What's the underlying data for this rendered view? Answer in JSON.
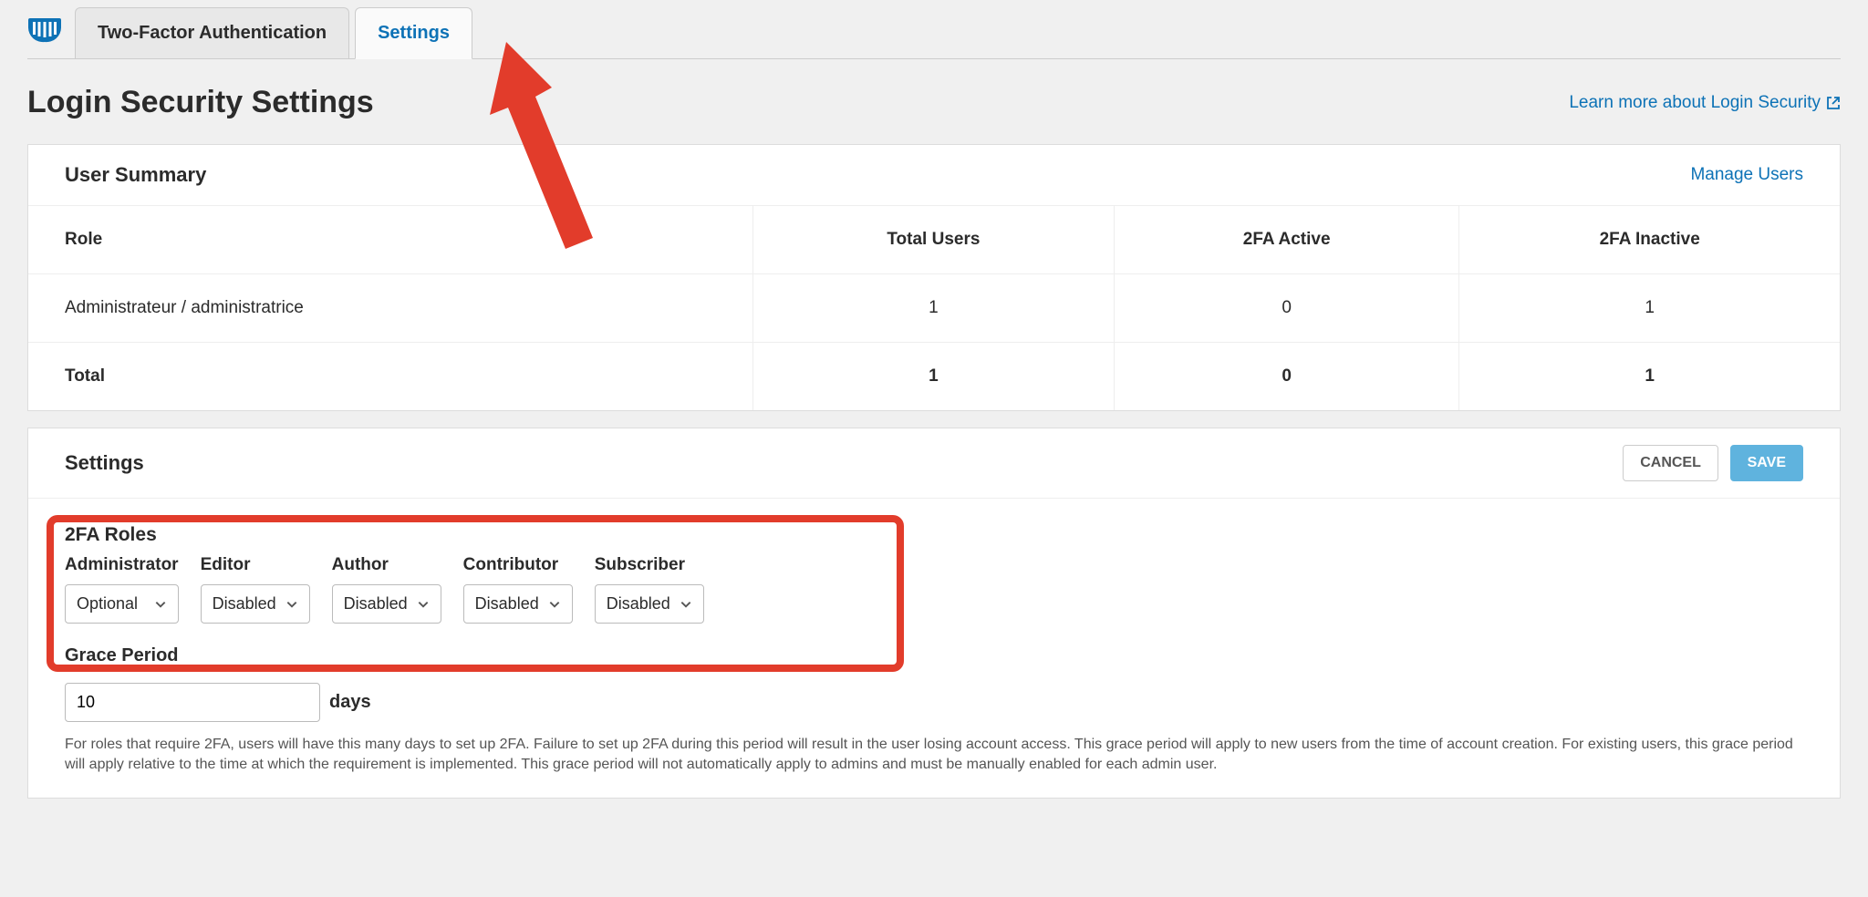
{
  "tabs": {
    "tfa": "Two-Factor Authentication",
    "settings": "Settings"
  },
  "header": {
    "title": "Login Security Settings",
    "learn_more": "Learn more about Login Security"
  },
  "user_summary": {
    "title": "User Summary",
    "manage_link": "Manage Users",
    "cols": {
      "role": "Role",
      "total": "Total Users",
      "active": "2FA Active",
      "inactive": "2FA Inactive"
    },
    "rows": [
      {
        "role": "Administrateur / administratrice",
        "total": "1",
        "active": "0",
        "inactive": "1"
      }
    ],
    "total_row": {
      "role": "Total",
      "total": "1",
      "active": "0",
      "inactive": "1"
    }
  },
  "settings": {
    "title": "Settings",
    "cancel": "CANCEL",
    "save": "SAVE",
    "tfa_roles_label": "2FA Roles",
    "roles": [
      {
        "name": "Administrator",
        "value": "Optional"
      },
      {
        "name": "Editor",
        "value": "Disabled"
      },
      {
        "name": "Author",
        "value": "Disabled"
      },
      {
        "name": "Contributor",
        "value": "Disabled"
      },
      {
        "name": "Subscriber",
        "value": "Disabled"
      }
    ],
    "grace": {
      "label": "Grace Period",
      "value": "10",
      "unit": "days",
      "help": "For roles that require 2FA, users will have this many days to set up 2FA. Failure to set up 2FA during this period will result in the user losing account access. This grace period will apply to new users from the time of account creation. For existing users, this grace period will apply relative to the time at which the requirement is implemented. This grace period will not automatically apply to admins and must be manually enabled for each admin user."
    }
  }
}
